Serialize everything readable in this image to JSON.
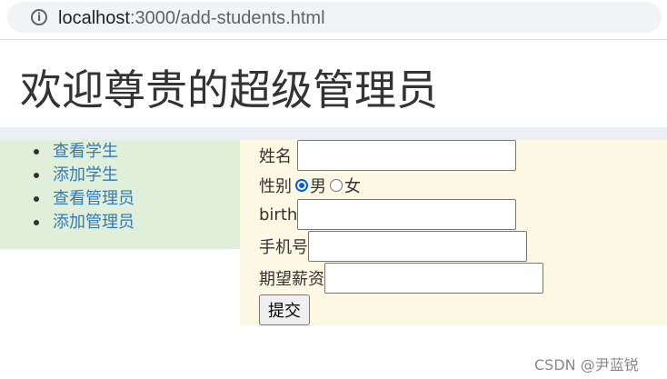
{
  "browser": {
    "url_host": "localhost",
    "url_path": ":3000/add-students.html",
    "info_icon": "info-icon"
  },
  "page": {
    "title": "欢迎尊贵的超级管理员"
  },
  "sidebar": {
    "items": [
      {
        "label": "查看学生"
      },
      {
        "label": "添加学生"
      },
      {
        "label": "查看管理员"
      },
      {
        "label": "添加管理员"
      }
    ]
  },
  "form": {
    "name_label": "姓名",
    "name_value": "",
    "gender_label": "性别",
    "gender_options": [
      {
        "label": "男",
        "checked": true
      },
      {
        "label": "女",
        "checked": false
      }
    ],
    "birth_label": "birth",
    "birth_value": "",
    "phone_label": "手机号",
    "phone_value": "",
    "salary_label": "期望薪资",
    "salary_value": "",
    "submit_label": "提交"
  },
  "watermark": "CSDN @尹蓝锐",
  "colors": {
    "sidebar_bg": "#dfefda",
    "form_bg": "#fcf8e3",
    "link": "#337ab7",
    "strip": "#eceef6"
  }
}
